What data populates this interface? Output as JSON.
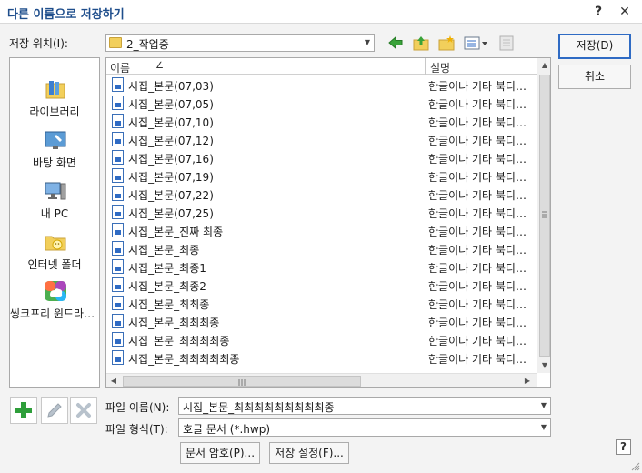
{
  "window": {
    "title": "다른 이름으로 저장하기",
    "help_label": "?",
    "close_label": "✕"
  },
  "location": {
    "label": "저장 위치(I):",
    "value": "2_작업중"
  },
  "places": [
    {
      "label": "라이브러리",
      "icon": "library-icon"
    },
    {
      "label": "바탕 화면",
      "icon": "desktop-icon"
    },
    {
      "label": "내 PC",
      "icon": "computer-icon"
    },
    {
      "label": "인터넷 폴더",
      "icon": "internet-folder-icon"
    },
    {
      "label": "씽크프리 윈드라이브",
      "icon": "cloud-drive-icon"
    }
  ],
  "columns": {
    "name": "이름",
    "sort_indicator": "∠",
    "type": "설명"
  },
  "files": [
    {
      "name": "시집_본문(07,03)",
      "type": "한글이나 기타 북디자인"
    },
    {
      "name": "시집_본문(07,05)",
      "type": "한글이나 기타 북디자인"
    },
    {
      "name": "시집_본문(07,10)",
      "type": "한글이나 기타 북디자인"
    },
    {
      "name": "시집_본문(07,12)",
      "type": "한글이나 기타 북디자인"
    },
    {
      "name": "시집_본문(07,16)",
      "type": "한글이나 기타 북디자인"
    },
    {
      "name": "시집_본문(07,19)",
      "type": "한글이나 기타 북디자인"
    },
    {
      "name": "시집_본문(07,22)",
      "type": "한글이나 기타 북디자인"
    },
    {
      "name": "시집_본문(07,25)",
      "type": "한글이나 기타 북디자인"
    },
    {
      "name": "시집_본문_진짜 최종",
      "type": "한글이나 기타 북디자인"
    },
    {
      "name": "시집_본문_최종",
      "type": "한글이나 기타 북디자인"
    },
    {
      "name": "시집_본문_최종1",
      "type": "한글이나 기타 북디자인"
    },
    {
      "name": "시집_본문_최종2",
      "type": "한글이나 기타 북디자인"
    },
    {
      "name": "시집_본문_최최종",
      "type": "한글이나 기타 북디자인"
    },
    {
      "name": "시집_본문_최최최종",
      "type": "한글이나 기타 북디자인"
    },
    {
      "name": "시집_본문_최최최최종",
      "type": "한글이나 기타 북디자인"
    },
    {
      "name": "시집_본문_최최최최최종",
      "type": "한글이나 기타 북디자인"
    }
  ],
  "filename": {
    "label": "파일 이름(N):",
    "value": "시집_본문_최최최최최최최최최종"
  },
  "filetype": {
    "label": "파일 형식(T):",
    "value": "호글 문서 (*.hwp)"
  },
  "buttons": {
    "save": "저장(D)",
    "cancel": "취소",
    "password": "문서 암호(P)...",
    "settings": "저장 설정(F)..."
  },
  "colors": {
    "accent": "#2f6bc4",
    "title": "#1f4e8c",
    "add_green": "#2e9e3a"
  }
}
